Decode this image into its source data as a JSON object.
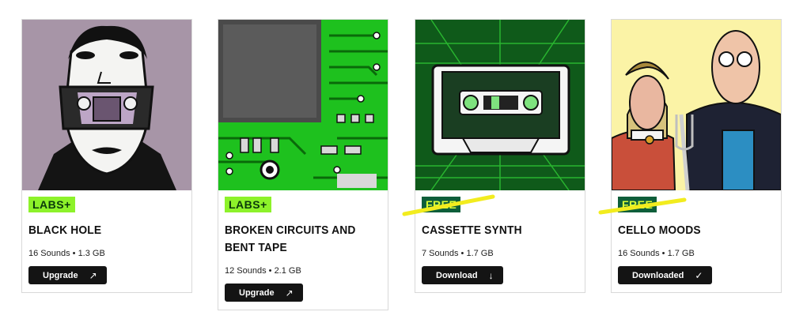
{
  "cards": [
    {
      "badge": "LABS+",
      "title": "BLACK HOLE",
      "info": "16 Sounds • 1.3 GB",
      "button": "Upgrade",
      "button_icon": "arrow-up-right-icon"
    },
    {
      "badge": "LABS+",
      "title": "BROKEN CIRCUITS AND BENT TAPE",
      "info": "12 Sounds • 2.1 GB",
      "button": "Upgrade",
      "button_icon": "arrow-up-right-icon"
    },
    {
      "badge": "FREE",
      "title": "CASSETTE SYNTH",
      "info": "7 Sounds • 1.7 GB",
      "button": "Download",
      "button_icon": "arrow-down-icon"
    },
    {
      "badge": "FREE",
      "title": "CELLO MOODS",
      "info": "16 Sounds • 1.7 GB",
      "button": "Downloaded",
      "button_icon": "check-icon"
    }
  ],
  "colors": {
    "labs_badge": "#8df22a",
    "free_badge": "#0e5e3a",
    "highlight": "#f2ec1e",
    "button": "#141414"
  }
}
